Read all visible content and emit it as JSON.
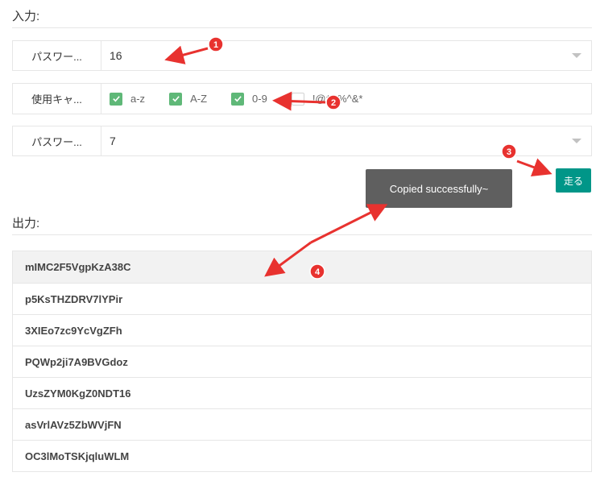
{
  "input": {
    "title": "入力:",
    "length_row": {
      "label": "パスワー...",
      "value": "16"
    },
    "chars_row": {
      "label": "使用キャ...",
      "options": [
        {
          "label": "a-z",
          "checked": true
        },
        {
          "label": "A-Z",
          "checked": true
        },
        {
          "label": "0-9",
          "checked": true
        },
        {
          "label": "!@#$%^&*",
          "checked": false
        }
      ]
    },
    "count_row": {
      "label": "パスワー...",
      "value": "7"
    },
    "run_label": "走る"
  },
  "toast": {
    "text": "Copied successfully~"
  },
  "output": {
    "title": "出力:",
    "passwords": [
      "mIMC2F5VgpKzA38C",
      "p5KsTHZDRV7lYPir",
      "3XIEo7zc9YcVgZFh",
      "PQWp2ji7A9BVGdoz",
      "UzsZYM0KgZ0NDT16",
      "asVrlAVz5ZbWVjFN",
      "OC3lMoTSKjqluWLM"
    ]
  },
  "annotations": [
    "1",
    "2",
    "3",
    "4"
  ],
  "colors": {
    "accent": "#009688",
    "checkbox": "#5fb878",
    "annotation": "#e8322f",
    "toast": "#5f5f5f"
  }
}
